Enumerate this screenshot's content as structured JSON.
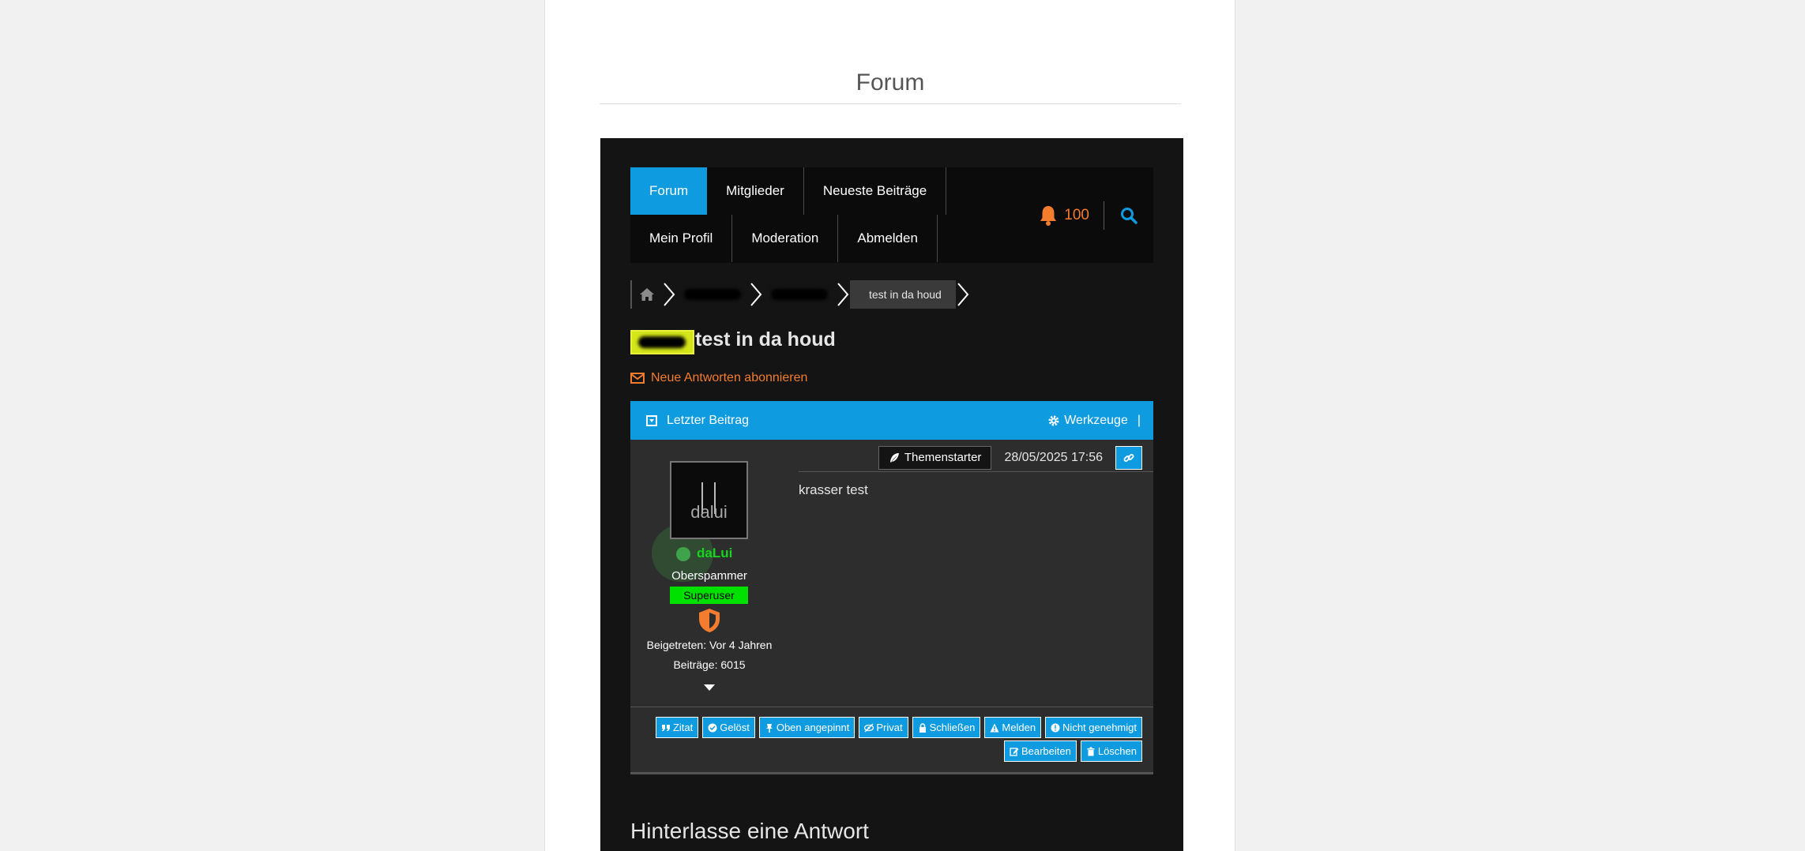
{
  "page": {
    "title": "Forum"
  },
  "nav": {
    "row1": [
      "Forum",
      "Mitglieder",
      "Neueste Beiträge"
    ],
    "row2": [
      "Mein Profil",
      "Moderation",
      "Abmelden"
    ],
    "notification_count": "100",
    "colors": {
      "accent": "#0f9be0",
      "notify": "#f47c2e"
    }
  },
  "breadcrumb": {
    "current": "test in da houd"
  },
  "topic": {
    "title": "test in da houd",
    "subscribe_label": "Neue Antworten abonnieren"
  },
  "postbar": {
    "last_post": "Letzter Beitrag",
    "tools": "Werkzeuge",
    "pipe": "|"
  },
  "post": {
    "starter_label": "Themenstarter",
    "date": "28/05/2025 17:56",
    "content": "krasser test",
    "author": {
      "avatar_text": "dalui",
      "name": "daLui",
      "rank": "Oberspammer",
      "role": "Superuser",
      "joined": "Beigetreten: Vor 4 Jahren",
      "posts": "Beiträge: 6015"
    }
  },
  "actions": {
    "row1": [
      "Zitat",
      "Gelöst",
      "Oben angepinnt",
      "Privat",
      "Schließen",
      "Melden",
      "Nicht genehmigt"
    ],
    "row2": [
      "Bearbeiten",
      "Löschen"
    ]
  },
  "reply": {
    "heading": "Hinterlasse eine Antwort"
  }
}
